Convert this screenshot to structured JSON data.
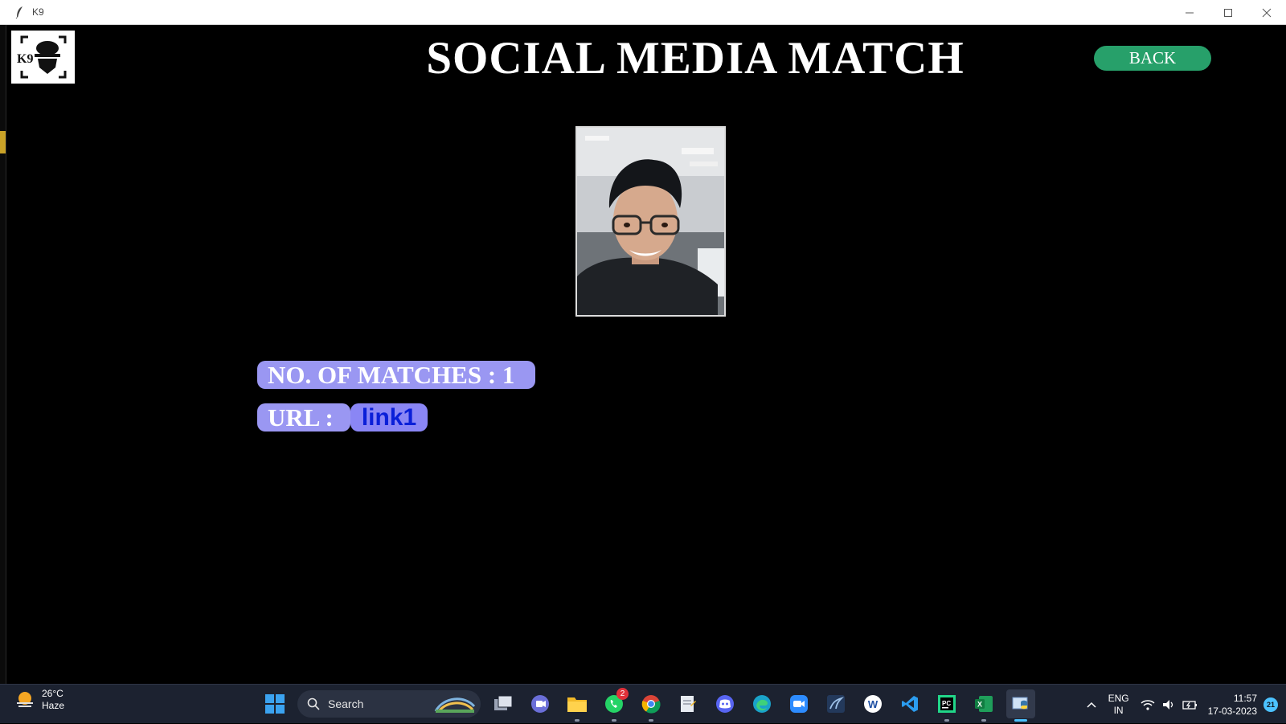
{
  "window": {
    "title": "K9"
  },
  "header": {
    "logo_text": "K9",
    "title": "SOCIAL MEDIA MATCH",
    "back_label": "BACK"
  },
  "results": {
    "matches_label": "NO. OF MATCHES : 1",
    "url_label": "URL :",
    "url_link": "link1"
  },
  "taskbar": {
    "weather_temp": "26°C",
    "weather_desc": "Haze",
    "search_placeholder": "Search",
    "whatsapp_badge": "2",
    "lang_line1": "ENG",
    "lang_line2": "IN",
    "time": "11:57",
    "date": "17-03-2023",
    "notification_count": "21"
  },
  "colors": {
    "background": "#000000",
    "back_button": "#27a06a",
    "pill": "#9a97f2",
    "link_text": "#0a1fd8",
    "taskbar": "#1c2230"
  }
}
